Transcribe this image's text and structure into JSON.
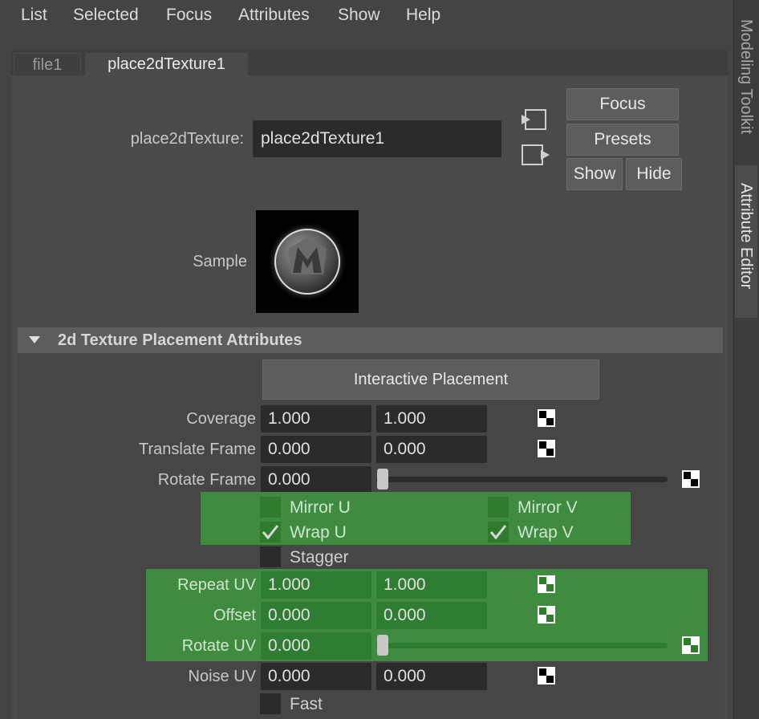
{
  "menu": [
    "List",
    "Selected",
    "Focus",
    "Attributes",
    "Show",
    "Help"
  ],
  "side_tabs": [
    "Modeling Toolkit",
    "Attribute Editor"
  ],
  "tabs": [
    "file1",
    "place2dTexture1"
  ],
  "node": {
    "label": "place2dTexture:",
    "value": "place2dTexture1"
  },
  "buttons": {
    "focus": "Focus",
    "presets": "Presets",
    "show": "Show",
    "hide": "Hide"
  },
  "sample_label": "Sample",
  "section": {
    "title": "2d Texture Placement Attributes",
    "interactive_placement": "Interactive Placement",
    "coverage": {
      "label": "Coverage",
      "u": "1.000",
      "v": "1.000"
    },
    "translate_frame": {
      "label": "Translate Frame",
      "u": "0.000",
      "v": "0.000"
    },
    "rotate_frame": {
      "label": "Rotate Frame",
      "value": "0.000"
    },
    "mirror_u": {
      "label": "Mirror U",
      "checked": false
    },
    "mirror_v": {
      "label": "Mirror V",
      "checked": false
    },
    "wrap_u": {
      "label": "Wrap U",
      "checked": true
    },
    "wrap_v": {
      "label": "Wrap V",
      "checked": true
    },
    "stagger": {
      "label": "Stagger",
      "checked": false
    },
    "repeat_uv": {
      "label": "Repeat UV",
      "u": "1.000",
      "v": "1.000"
    },
    "offset": {
      "label": "Offset",
      "u": "0.000",
      "v": "0.000"
    },
    "rotate_uv": {
      "label": "Rotate UV",
      "value": "0.000"
    },
    "noise_uv": {
      "label": "Noise UV",
      "u": "0.000",
      "v": "0.000"
    },
    "fast": {
      "label": "Fast",
      "checked": false
    }
  },
  "colors": {
    "panel": "#444444",
    "field": "#2b2b2b",
    "keyed_green": "#3f8b3f",
    "section_header": "#5d5d5d"
  }
}
